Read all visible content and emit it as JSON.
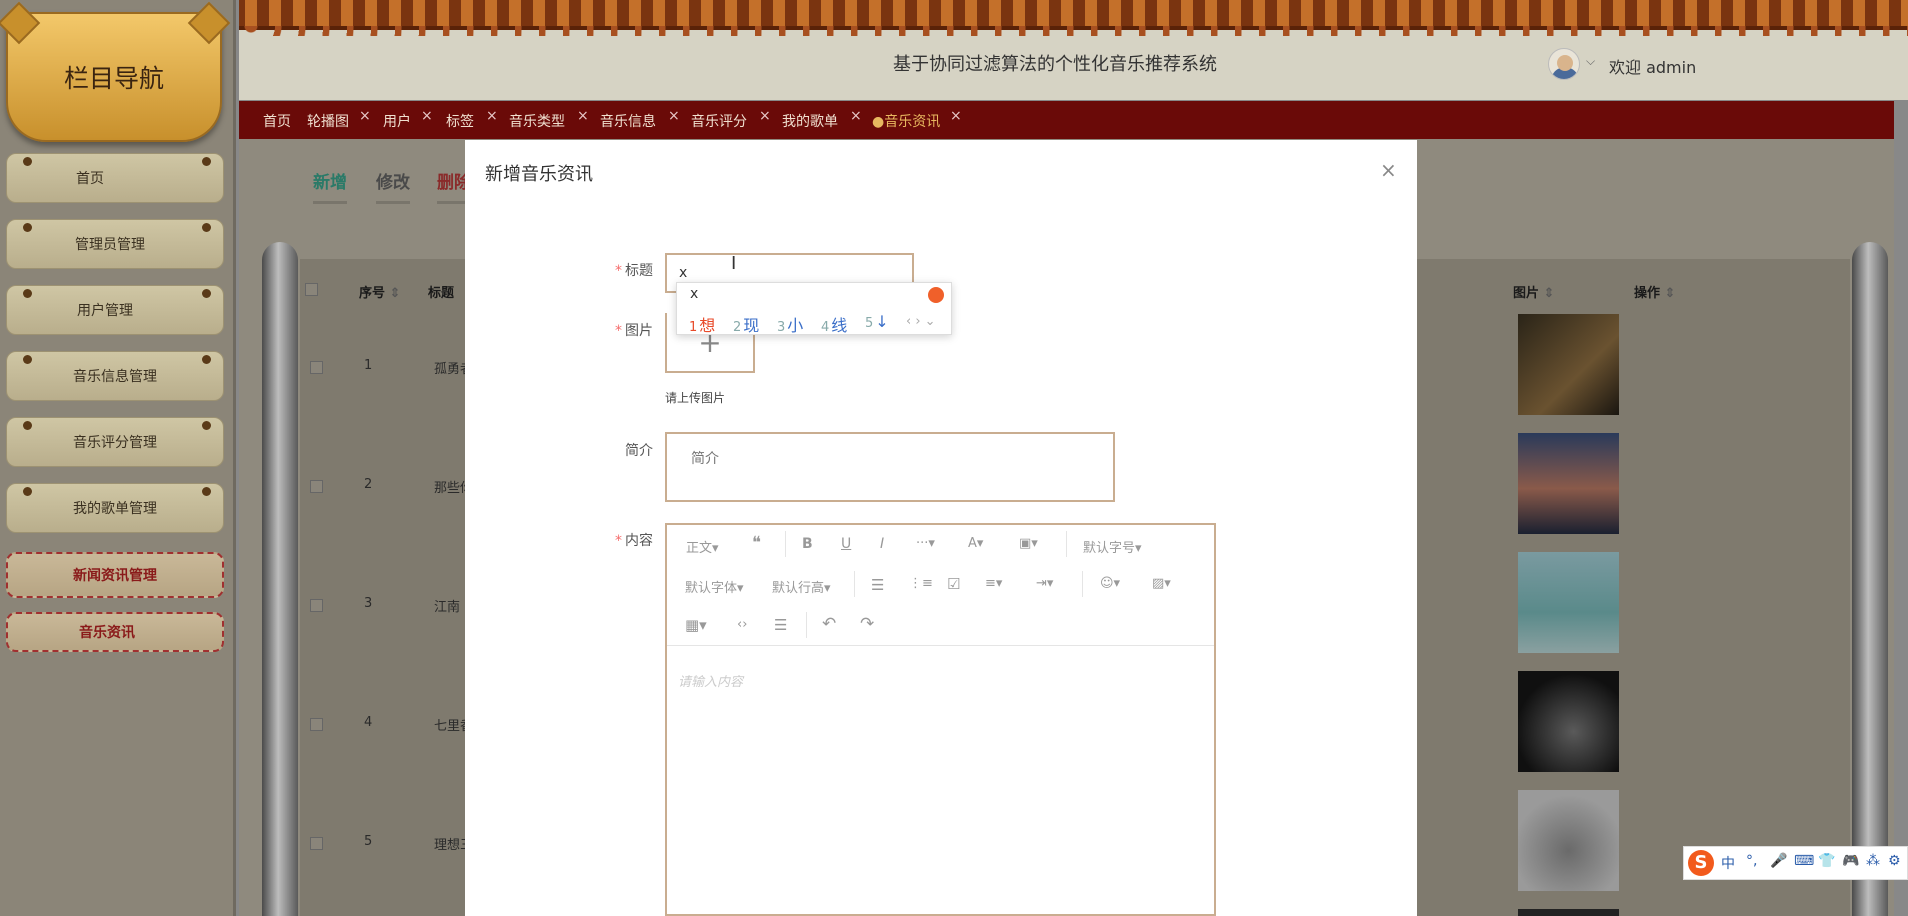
{
  "sidebar": {
    "title": "栏目导航",
    "items": [
      {
        "label": "首页"
      },
      {
        "label": "管理员管理"
      },
      {
        "label": "用户管理"
      },
      {
        "label": "音乐信息管理"
      },
      {
        "label": "音乐评分管理"
      },
      {
        "label": "我的歌单管理"
      },
      {
        "label": "新闻资讯管理"
      },
      {
        "label": "音乐资讯"
      }
    ]
  },
  "header": {
    "system_title": "基于协同过滤算法的个性化音乐推荐系统",
    "welcome": "欢迎 admin",
    "user_menu_arrow": "⌵"
  },
  "tabs": [
    {
      "label": "首页"
    },
    {
      "label": "轮播图"
    },
    {
      "label": "用户"
    },
    {
      "label": "标签"
    },
    {
      "label": "音乐类型"
    },
    {
      "label": "音乐信息"
    },
    {
      "label": "音乐评分"
    },
    {
      "label": "我的歌单"
    },
    {
      "label": "●音乐资讯"
    }
  ],
  "tab_close": "×",
  "actions": {
    "add": "新增",
    "edit": "修改",
    "delete": "删除"
  },
  "table": {
    "headers": [
      "序号",
      "标题",
      "图片",
      "操作"
    ],
    "sort_icon": "⇕",
    "rows": [
      {
        "index": "1",
        "title": "孤勇者"
      },
      {
        "index": "2",
        "title": "那些你"
      },
      {
        "index": "3",
        "title": "江南"
      },
      {
        "index": "4",
        "title": "七里香"
      },
      {
        "index": "5",
        "title": "理想三"
      }
    ]
  },
  "modal": {
    "title": "新增音乐资讯",
    "close": "×",
    "fields": {
      "title_label": "标题",
      "title_value": "x",
      "image_label": "图片",
      "upload_plus": "+",
      "upload_hint": "请上传图片",
      "summary_label": "简介",
      "summary_placeholder": "简介",
      "content_label": "内容",
      "content_placeholder": "请输入内容",
      "required_mark": "*"
    },
    "editor_toolbar": {
      "paragraph": "正文▾",
      "quote": "❝",
      "bold": "B",
      "underline": "U",
      "italic": "I",
      "more": "···▾",
      "font_color": "A▾",
      "bg_color": "▣▾",
      "font_size": "默认字号▾",
      "font_family": "默认字体▾",
      "line_height": "默认行高▾",
      "bullet_list": "☰",
      "number_list": "⋮≡",
      "todo": "☑",
      "align": "≡▾",
      "indent": "⇥▾",
      "emoji": "☺▾",
      "image": "▨▾",
      "table": "▦▾",
      "code": "‹›",
      "divider": "☰",
      "undo": "↶",
      "redo": "↷"
    }
  },
  "ime_popup": {
    "input": "x",
    "candidates": [
      {
        "n": "1",
        "text": "想"
      },
      {
        "n": "2",
        "text": "现"
      },
      {
        "n": "3",
        "text": "小"
      },
      {
        "n": "4",
        "text": "线"
      },
      {
        "n": "5",
        "text": "↓"
      }
    ],
    "nav": "‹ › ⌄"
  },
  "ime_bar": {
    "logo": "S",
    "mode": "中",
    "punct": "°,",
    "items": [
      "🎤",
      "⌨",
      "👕",
      "🎮",
      "⁂",
      "⚙"
    ]
  },
  "colors": {
    "accent_red": "#6a0a08",
    "active_tab": "#e8b860",
    "add_green": "#2aa88a",
    "delete_red": "#c84040"
  }
}
